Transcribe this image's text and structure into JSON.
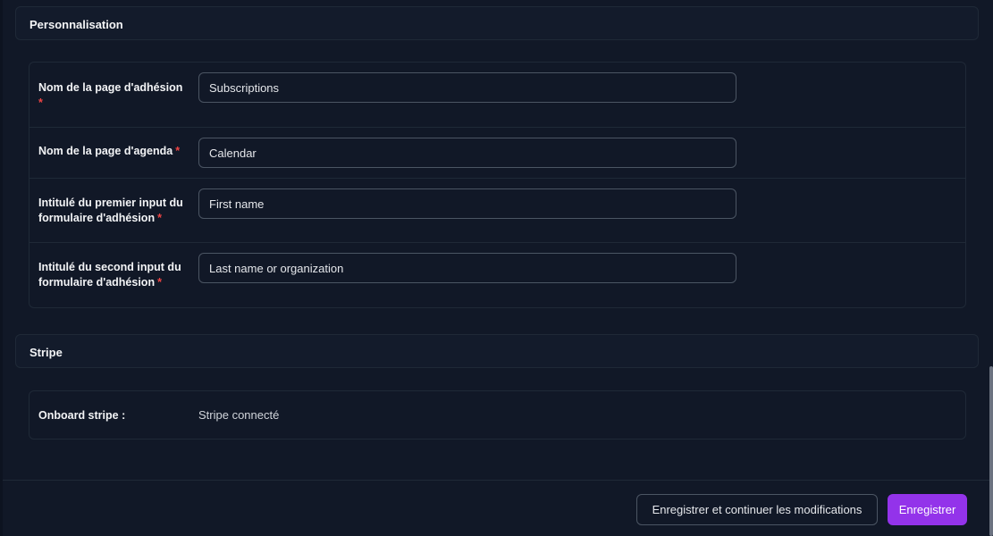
{
  "personalisation": {
    "title": "Personnalisation",
    "fields": [
      {
        "label": "Nom de la page d'adhésion",
        "value": "Subscriptions",
        "required": "*"
      },
      {
        "label": "Nom de la page d'agenda",
        "value": "Calendar",
        "required": "*"
      },
      {
        "label": "Intitulé du premier input du formulaire d'adhésion",
        "value": "First name",
        "required": "*"
      },
      {
        "label": "Intitulé du second input du formulaire d'adhésion",
        "value": "Last name or organization",
        "required": "*"
      }
    ]
  },
  "stripe": {
    "title": "Stripe",
    "onboard_label": "Onboard stripe :",
    "onboard_value": "Stripe connecté"
  },
  "footer": {
    "save_continue_label": "Enregistrer et continuer les modifications",
    "save_label": "Enregistrer"
  },
  "colors": {
    "background": "#111827",
    "accent": "#9333ea",
    "required": "#ef4444"
  }
}
